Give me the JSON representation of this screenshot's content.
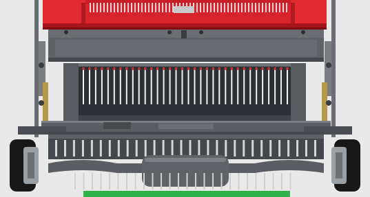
{
  "figure": {
    "subject": "",
    "background": "#e9e9e9"
  },
  "colors": {
    "hopper_red": "#d9232b",
    "hopper_red_dark": "#a8141b",
    "frame_gray": "#5e6266",
    "frame_dark": "#3f4246",
    "steel_light": "#9ea2a6",
    "tine": "#f2f2f2",
    "tire": "#171717",
    "rim": "#9aa0a4",
    "ground_strip": "#2fb24a"
  },
  "parts": {
    "tine_rows": 2,
    "upper_tine_count": 34,
    "lower_tine_count": 30,
    "wheel_count": 2
  }
}
